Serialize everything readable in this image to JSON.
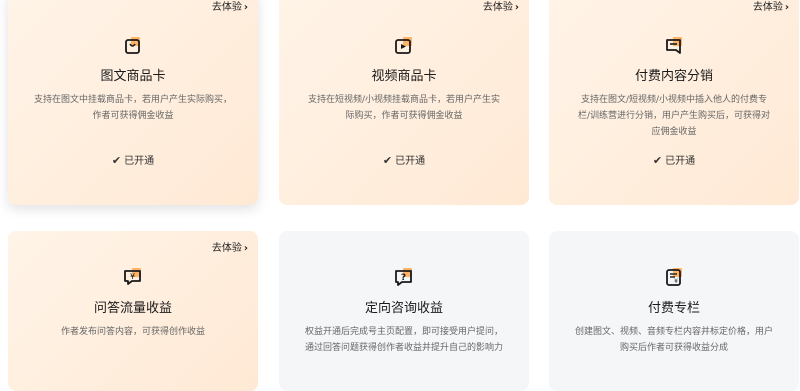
{
  "try_label": "去体验",
  "chevron": "›",
  "check": "✔",
  "cards": [
    {
      "icon": "shopping-bag-icon",
      "title": "图文商品卡",
      "desc": "支持在图文中挂载商品卡，若用户产生实际购买，作者可获得佣金收益",
      "status": "已开通"
    },
    {
      "icon": "video-product-icon",
      "title": "视频商品卡",
      "desc": "支持在短视频/小视频挂载商品卡，若用户产生实际购买，作者可获得佣金收益",
      "status": "已开通"
    },
    {
      "icon": "paid-content-icon",
      "title": "付费内容分销",
      "desc": "支持在图文/短视频/小视频中插入他人的付费专栏/训练营进行分销，用户产生购买后，可获得对应佣金收益",
      "status": "已开通"
    },
    {
      "icon": "qa-income-icon",
      "title": "问答流量收益",
      "desc": "作者发布问答内容，可获得创作收益"
    },
    {
      "icon": "consult-income-icon",
      "title": "定向咨询收益",
      "desc": "权益开通后完成号主页配置，即可接受用户提问，通过回答问题获得创作者收益并提升自己的影响力"
    },
    {
      "icon": "paid-column-icon",
      "title": "付费专栏",
      "desc": "创建图文、视频、音频专栏内容并标定价格，用户购买后作者可获得收益分成"
    }
  ],
  "colors": {
    "accent": "#ff7a1a",
    "icon_stroke": "#1a1a1a"
  }
}
